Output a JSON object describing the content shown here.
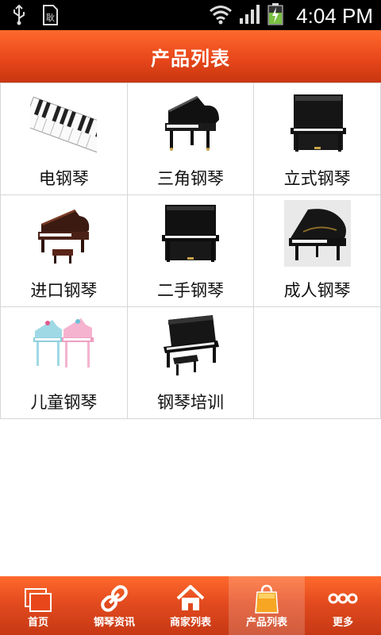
{
  "status_bar": {
    "time": "4:04 PM",
    "icons": [
      "usb-icon",
      "sd-card-icon",
      "wifi-icon",
      "signal-icon",
      "battery-charging-icon"
    ]
  },
  "header": {
    "title": "产品列表"
  },
  "grid": {
    "items": [
      {
        "label": "电钢琴",
        "icon": "digital-piano-keys"
      },
      {
        "label": "三角钢琴",
        "icon": "grand-piano"
      },
      {
        "label": "立式钢琴",
        "icon": "upright-piano"
      },
      {
        "label": "进口钢琴",
        "icon": "grand-piano-with-bench"
      },
      {
        "label": "二手钢琴",
        "icon": "upright-piano"
      },
      {
        "label": "成人钢琴",
        "icon": "grand-piano"
      },
      {
        "label": "儿童钢琴",
        "icon": "toy-pianos"
      },
      {
        "label": "钢琴培训",
        "icon": "upright-piano-with-bench"
      }
    ]
  },
  "bottom_nav": {
    "items": [
      {
        "label": "首页",
        "icon": "home-pages-icon"
      },
      {
        "label": "钢琴资讯",
        "icon": "link-icon"
      },
      {
        "label": "商家列表",
        "icon": "house-icon"
      },
      {
        "label": "产品列表",
        "icon": "shopping-bag-icon",
        "active": true
      },
      {
        "label": "更多",
        "icon": "more-dots-icon"
      }
    ]
  },
  "colors": {
    "accent": "#e8471b",
    "grid_border": "#d6d6d6"
  }
}
